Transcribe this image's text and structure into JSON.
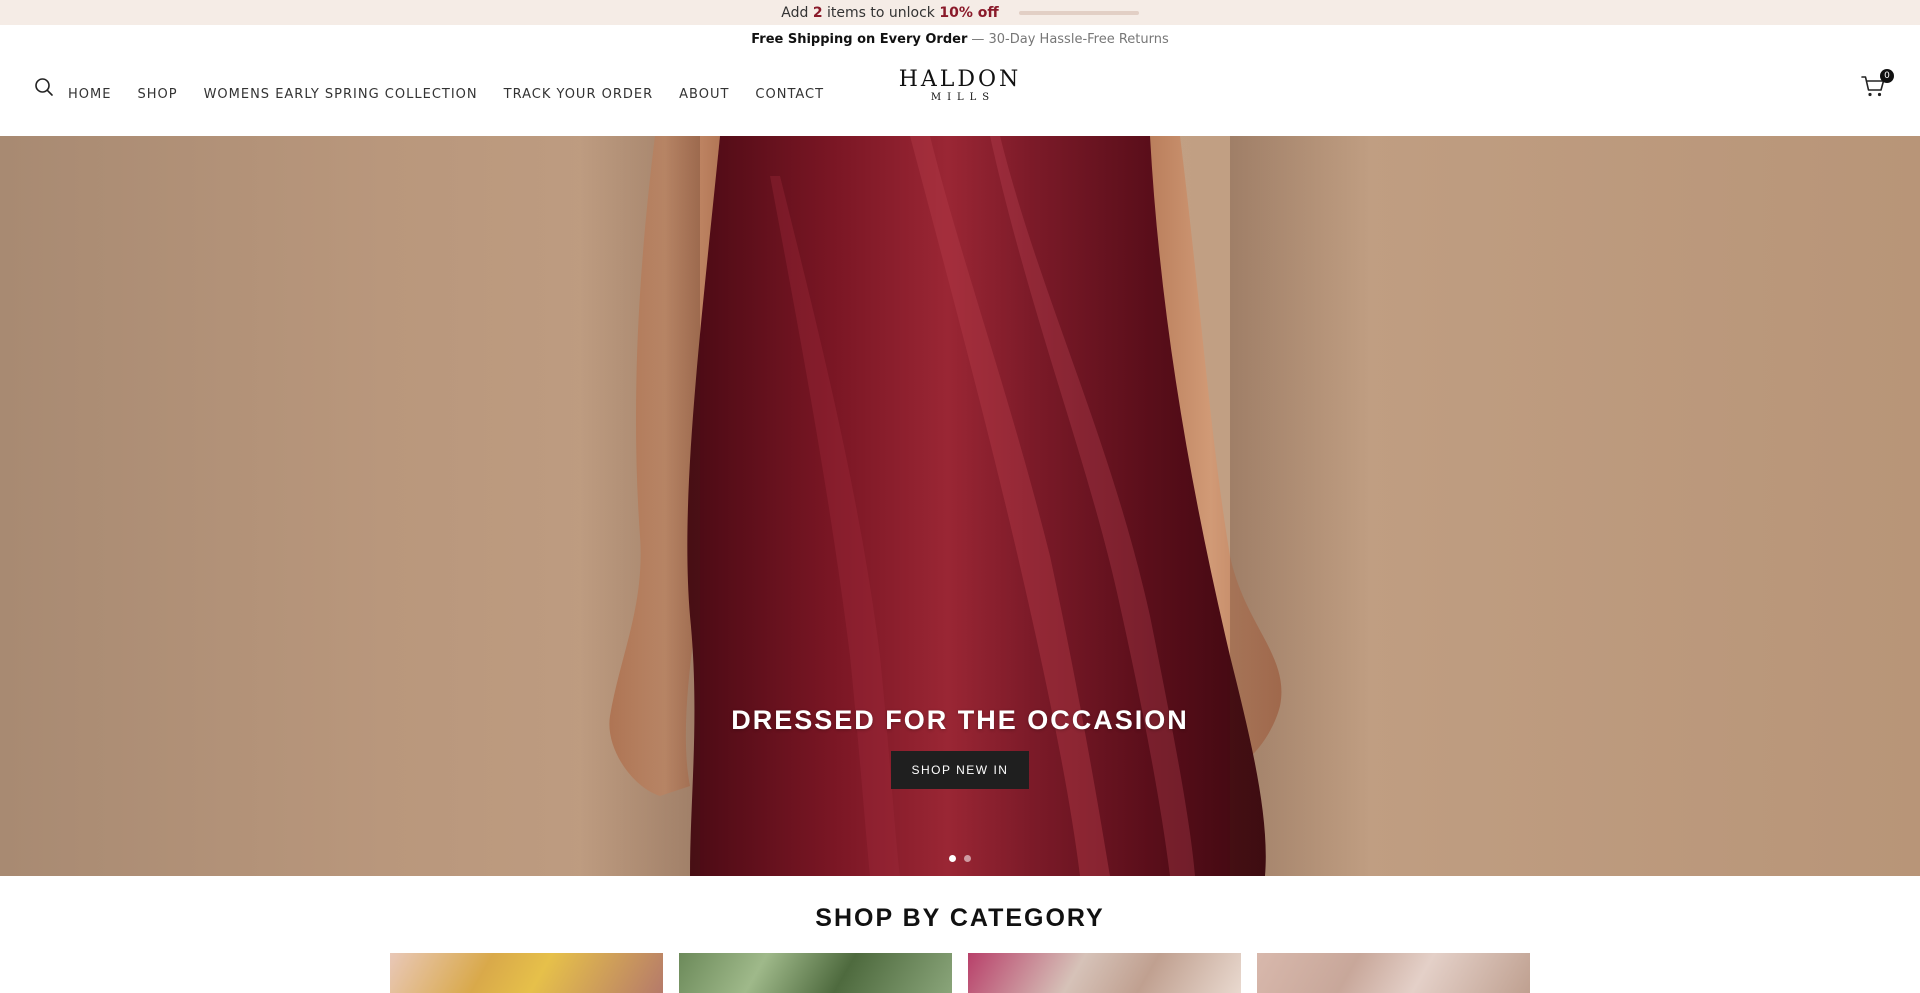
{
  "promo": {
    "prefix": "Add",
    "count": "2",
    "middle": "items to unlock",
    "discount": "10% off",
    "progress_fraction": 0.0
  },
  "shipping": {
    "bold": "Free Shipping on Every Order",
    "rest": "— 30-Day Hassle-Free Returns"
  },
  "nav": {
    "items": [
      "HOME",
      "SHOP",
      "WOMENS EARLY SPRING COLLECTION",
      "TRACK YOUR ORDER",
      "ABOUT",
      "CONTACT"
    ]
  },
  "logo": {
    "main": "HALDON",
    "sub": "MILLS"
  },
  "cart": {
    "count": "0"
  },
  "hero": {
    "heading": "DRESSED FOR THE OCCASION",
    "button_label": "SHOP NEW IN",
    "slides": 2,
    "active_slide": 1
  },
  "category": {
    "title": "SHOP BY CATEGORY"
  },
  "colors": {
    "accent": "#8a1a2a",
    "button_bg": "#1f1f1f",
    "promo_bg": "#f5ece6"
  }
}
